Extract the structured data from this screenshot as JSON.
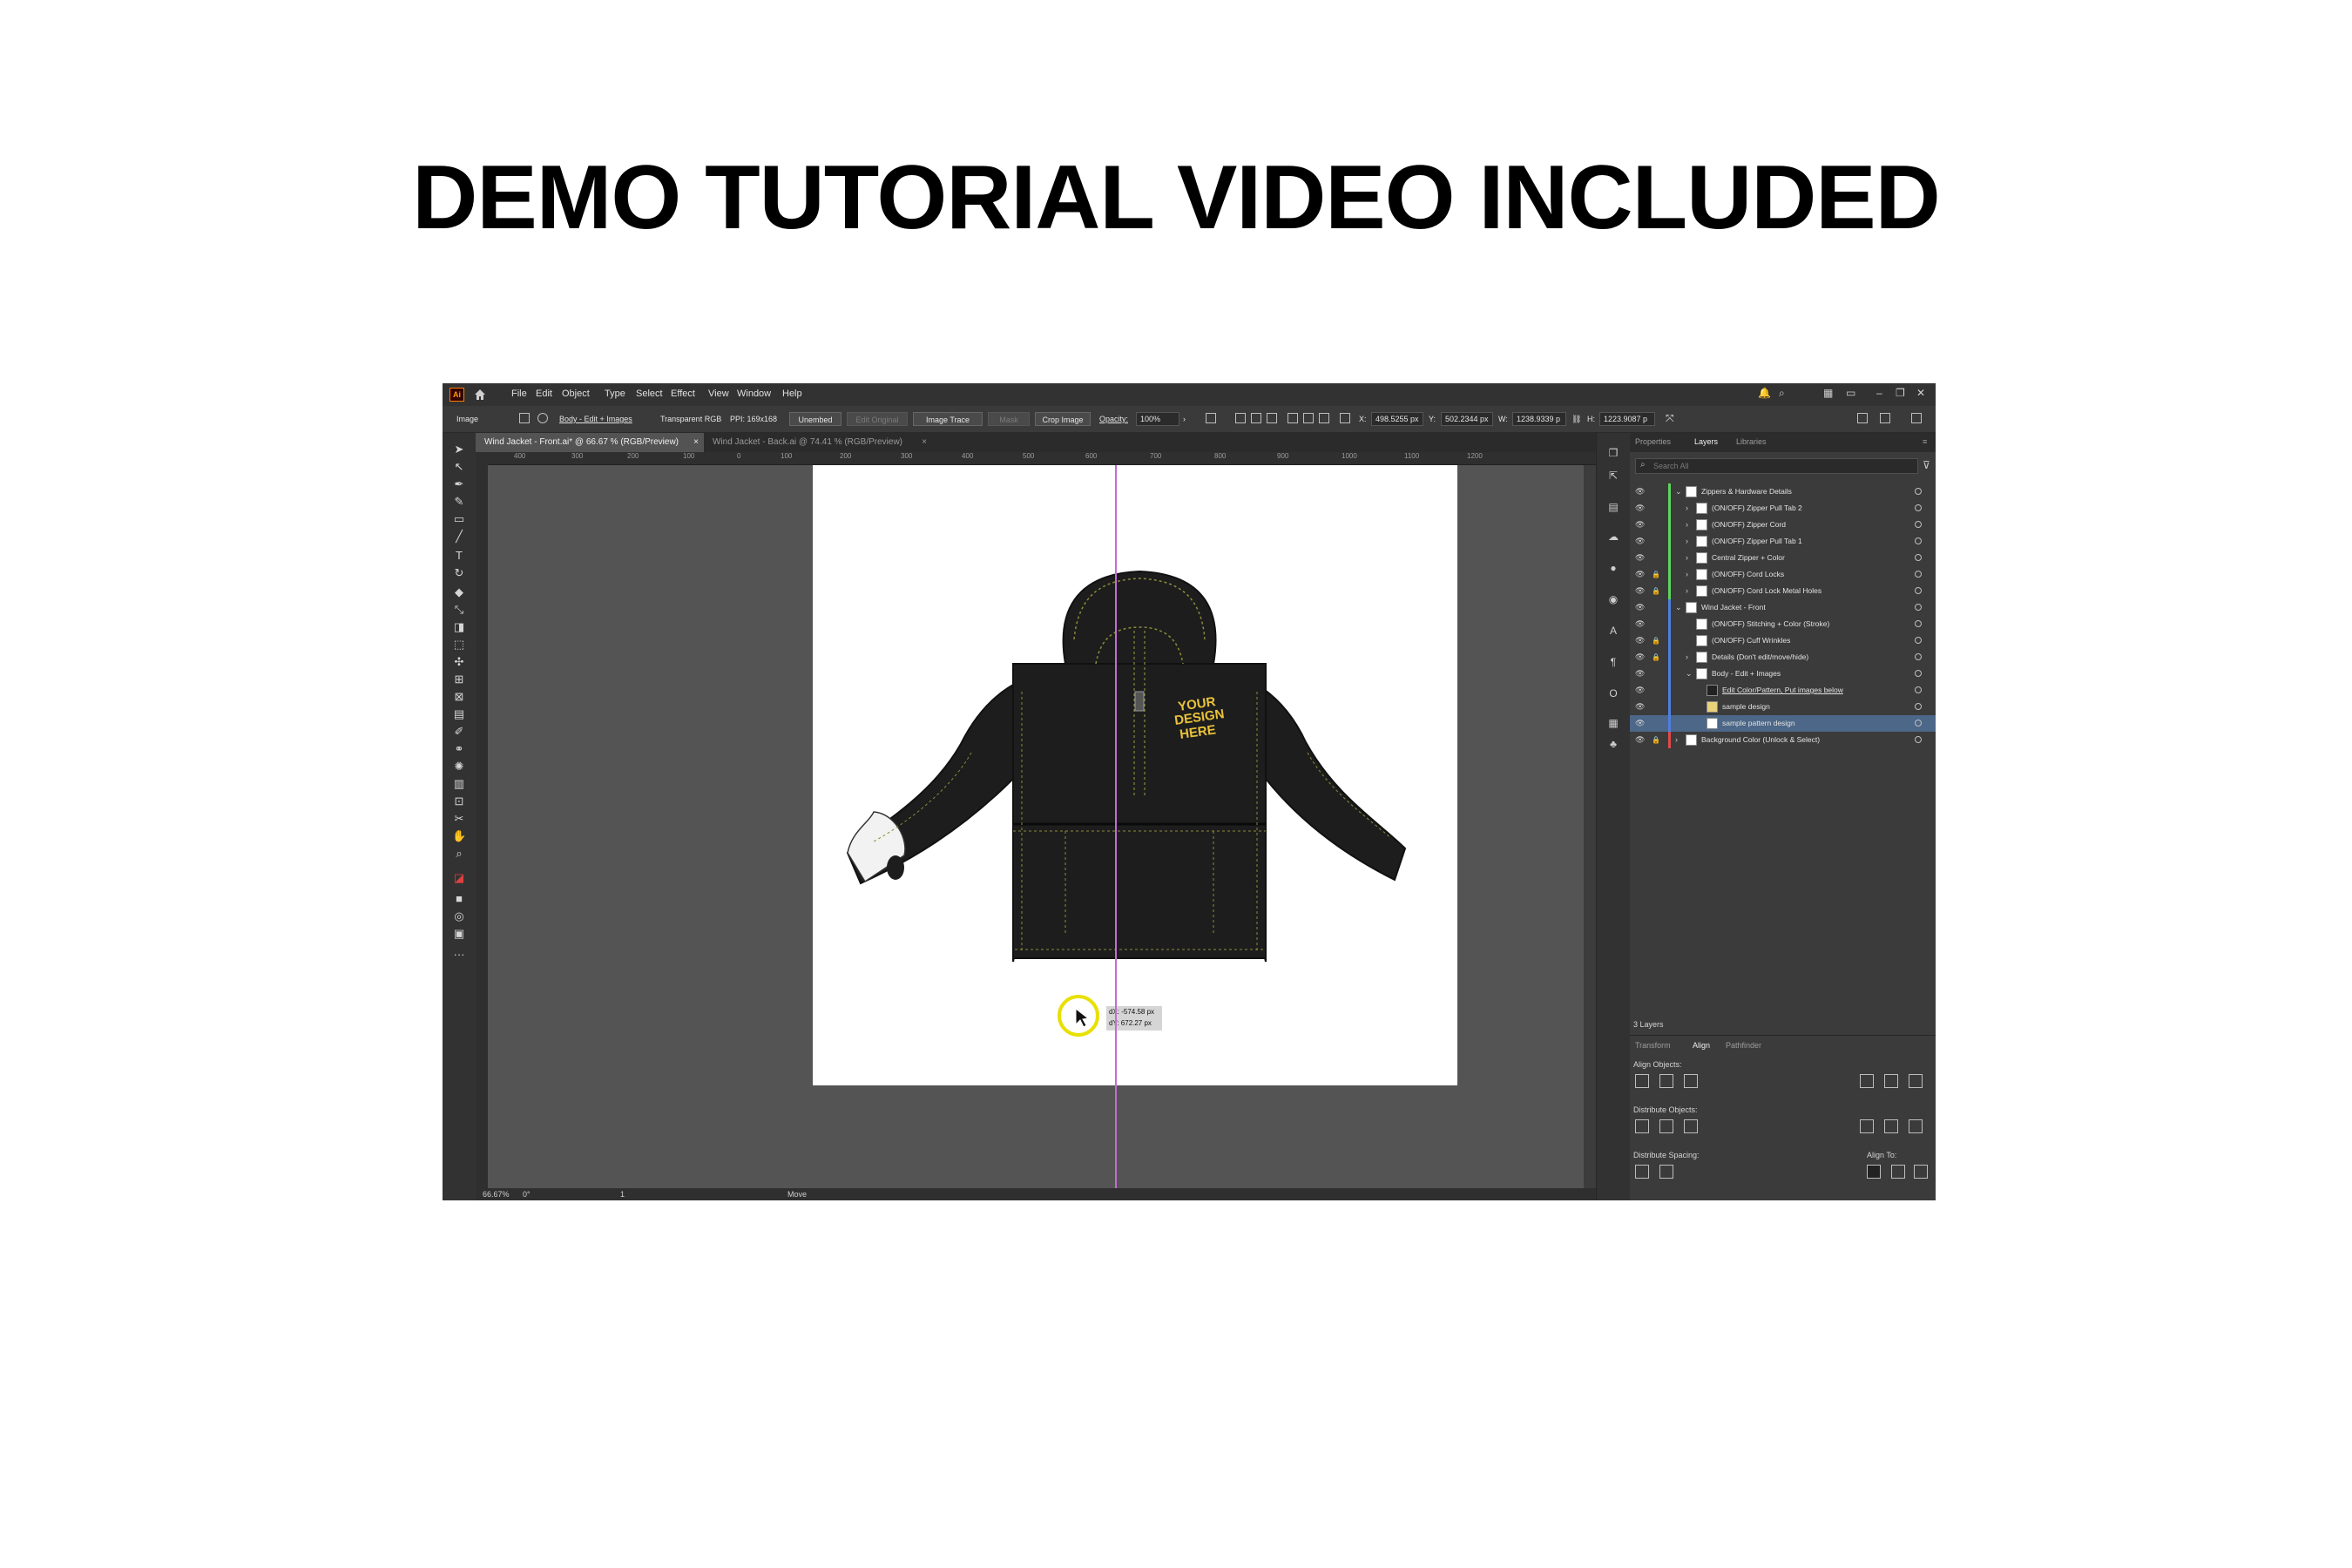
{
  "headline": "DEMO TUTORIAL VIDEO INCLUDED",
  "app": {
    "logo": "Ai",
    "menu": [
      "File",
      "Edit",
      "Object",
      "Type",
      "Select",
      "Effect",
      "View",
      "Window",
      "Help"
    ]
  },
  "control_bar": {
    "object_type": "Image",
    "layer_name": "Body - Edit + Images",
    "color_mode": "Transparent RGB",
    "ppi": "PPI: 169x168",
    "unembed": "Unembed",
    "edit_original": "Edit Original",
    "image_trace": "Image Trace",
    "mask": "Mask",
    "crop_image": "Crop Image",
    "opacity_label": "Opacity:",
    "opacity_value": "100%",
    "x_label": "X:",
    "x_value": "498.5255 px",
    "y_label": "Y:",
    "y_value": "502.2344 px",
    "w_label": "W:",
    "w_value": "1238.9339 p",
    "h_label": "H:",
    "h_value": "1223.9087 p"
  },
  "tabs": [
    {
      "label": "Wind Jacket - Front.ai* @ 66.67 % (RGB/Preview)"
    },
    {
      "label": "Wind Jacket - Back.ai @ 74.41 % (RGB/Preview)"
    }
  ],
  "tab_close": "×",
  "ruler_labels": [
    "400",
    "300",
    "200",
    "100",
    "0",
    "100",
    "200",
    "300",
    "400",
    "500",
    "600",
    "700",
    "800",
    "900",
    "1000",
    "1100",
    "1200"
  ],
  "artwork": {
    "design_text": [
      "YOUR",
      "DESIGN",
      "HERE"
    ]
  },
  "tooltip": {
    "dx": "dX: -574.58 px",
    "dy": "dY: 672.27 px"
  },
  "status_bar": {
    "zoom": "66.67%",
    "rotation": "0°",
    "artboard": "1",
    "tool": "Move"
  },
  "panel_tabs": {
    "properties": "Properties",
    "layers": "Layers",
    "libraries": "Libraries"
  },
  "search_placeholder": "Search All",
  "layers": [
    {
      "name": "Zippers & Hardware Details",
      "indent": 0,
      "lock": false,
      "expander": "⌄"
    },
    {
      "name": "(ON/OFF) Zipper Pull Tab 2",
      "indent": 1,
      "lock": false,
      "expander": "›"
    },
    {
      "name": "(ON/OFF) Zipper Cord",
      "indent": 1,
      "lock": false,
      "expander": "›"
    },
    {
      "name": "(ON/OFF) Zipper Pull Tab 1",
      "indent": 1,
      "lock": false,
      "expander": "›"
    },
    {
      "name": "Central Zipper + Color",
      "indent": 1,
      "lock": false,
      "expander": "›"
    },
    {
      "name": "(ON/OFF) Cord Locks",
      "indent": 1,
      "lock": true,
      "expander": "›"
    },
    {
      "name": "(ON/OFF) Cord Lock Metal Holes",
      "indent": 1,
      "lock": true,
      "expander": "›"
    },
    {
      "name": "Wind Jacket - Front",
      "indent": 0,
      "lock": false,
      "expander": "⌄"
    },
    {
      "name": "(ON/OFF) Stitching + Color (Stroke)",
      "indent": 1,
      "lock": false,
      "expander": ""
    },
    {
      "name": "(ON/OFF) Cuff Wrinkles",
      "indent": 1,
      "lock": true,
      "expander": ""
    },
    {
      "name": "Details (Don't edit/move/hide)",
      "indent": 1,
      "lock": true,
      "expander": "›"
    },
    {
      "name": "Body - Edit + Images",
      "indent": 1,
      "lock": false,
      "expander": "⌄"
    },
    {
      "name": "Edit Color/Pattern, Put images below",
      "indent": 2,
      "lock": false,
      "expander": ""
    },
    {
      "name": "sample design",
      "indent": 2,
      "lock": false,
      "expander": ""
    },
    {
      "name": "sample pattern design",
      "indent": 2,
      "lock": false,
      "expander": "",
      "selected": true
    },
    {
      "name": "Background Color (Unlock & Select)",
      "indent": 0,
      "lock": true,
      "expander": "›"
    }
  ],
  "layers_count": "3 Layers",
  "lower_panel": {
    "tabs": [
      "Transform",
      "Align",
      "Pathfinder"
    ],
    "align_objects": "Align Objects:",
    "distribute_objects": "Distribute Objects:",
    "distribute_spacing": "Distribute Spacing:",
    "align_to": "Align To:"
  },
  "colors": {
    "ui_dark": "#323232",
    "canvas": "#545454",
    "selection": "#4c6787",
    "guide": "#c66bd6",
    "jacket": "#1d1d1d",
    "stitch": "#8a8a3a",
    "design_text": "#e8c23a"
  }
}
